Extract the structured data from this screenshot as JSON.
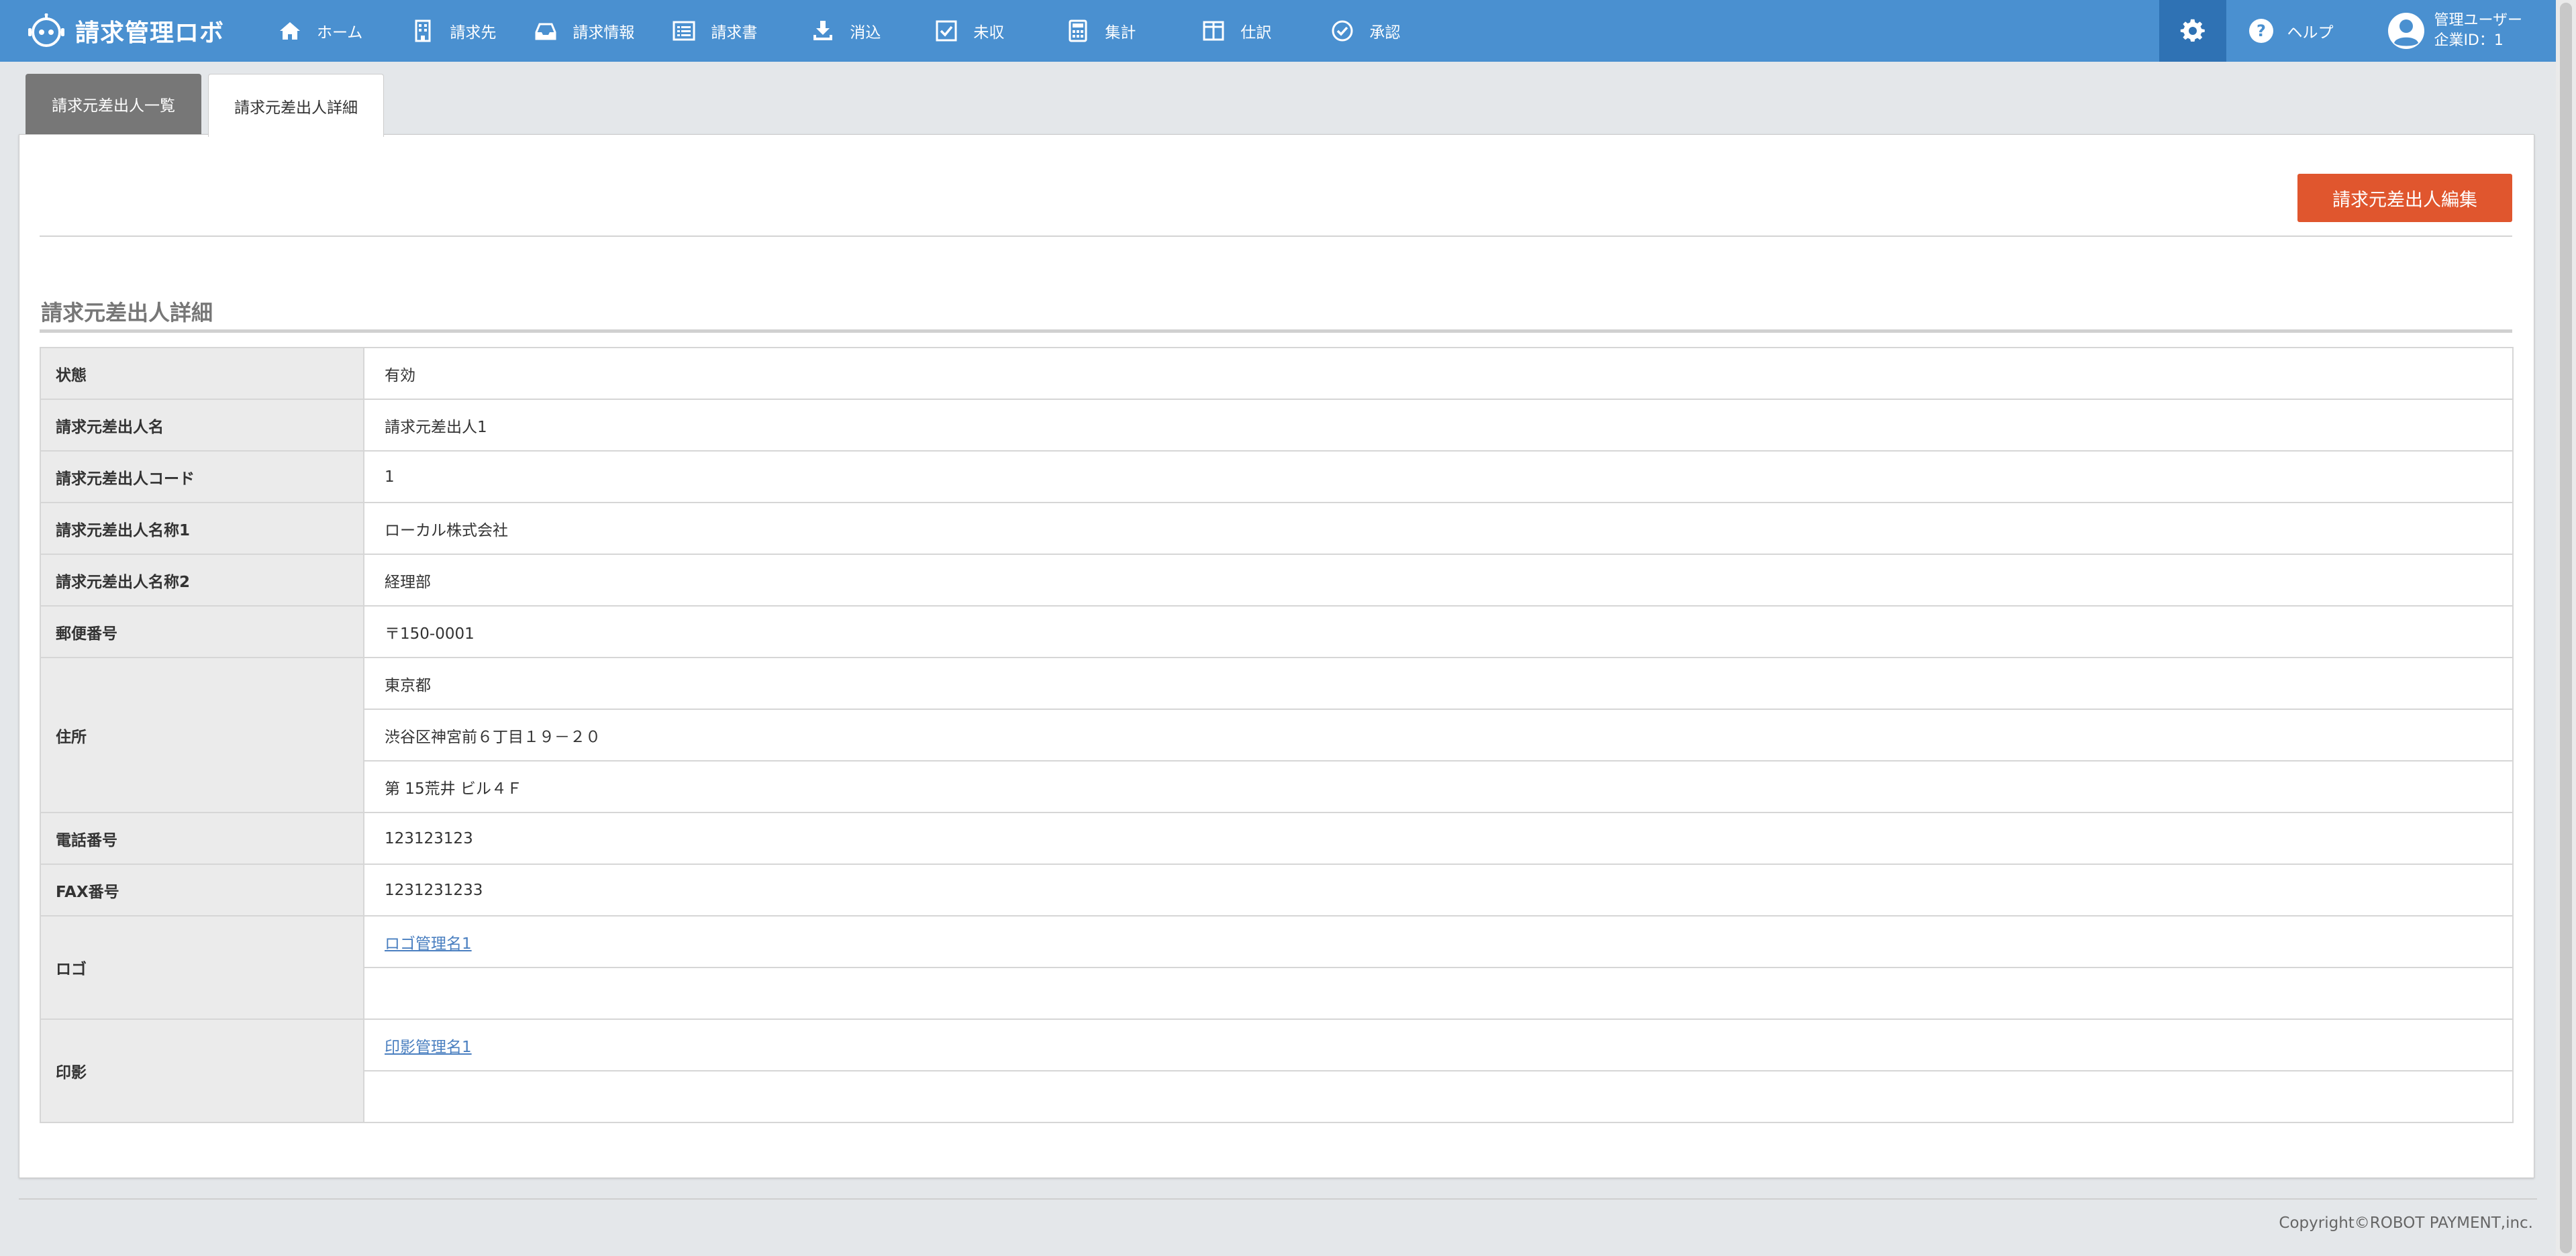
{
  "app": {
    "logo_text": "請求管理ロボ"
  },
  "nav": [
    {
      "label": "ホーム",
      "icon": "home-icon"
    },
    {
      "label": "請求先",
      "icon": "building-icon"
    },
    {
      "label": "請求情報",
      "icon": "inbox-icon"
    },
    {
      "label": "請求書",
      "icon": "list-icon"
    },
    {
      "label": "消込",
      "icon": "download-icon"
    },
    {
      "label": "未収",
      "icon": "checkbox-icon"
    },
    {
      "label": "集計",
      "icon": "calculator-icon"
    },
    {
      "label": "仕訳",
      "icon": "columns-icon"
    },
    {
      "label": "承認",
      "icon": "check-circle-icon"
    }
  ],
  "header": {
    "help_label": "ヘルプ",
    "user_name": "管理ユーザー",
    "company_id": "企業ID：1"
  },
  "tabs": {
    "list_label": "請求元差出人一覧",
    "detail_label": "請求元差出人詳細"
  },
  "panel": {
    "edit_button": "請求元差出人編集",
    "section_title": "請求元差出人詳細"
  },
  "details": {
    "status_label": "状態",
    "status_value": "有効",
    "name_label": "請求元差出人名",
    "name_value": "請求元差出人1",
    "code_label": "請求元差出人コード",
    "code_value": "1",
    "title1_label": "請求元差出人名称1",
    "title1_value": "ローカル株式会社",
    "title2_label": "請求元差出人名称2",
    "title2_value": "経理部",
    "zip_label": "郵便番号",
    "zip_value": "〒150-0001",
    "address_label": "住所",
    "address_line1": "東京都",
    "address_line2": "渋谷区神宮前６丁目１９－２０",
    "address_line3": "第 15荒井 ビル４Ｆ",
    "phone_label": "電話番号",
    "phone_value": "123123123",
    "fax_label": "FAX番号",
    "fax_value": "1231231233",
    "logo_label": "ロゴ",
    "logo_link": "ロゴ管理名1",
    "stamp_label": "印影",
    "stamp_link": "印影管理名1"
  },
  "footer": {
    "copyright": "Copyright©ROBOT PAYMENT,inc."
  },
  "colors": {
    "header_bg": "#4a90d0",
    "gear_bg": "#2f72b4",
    "edit_button": "#e0562e",
    "link": "#4a7fc0"
  }
}
